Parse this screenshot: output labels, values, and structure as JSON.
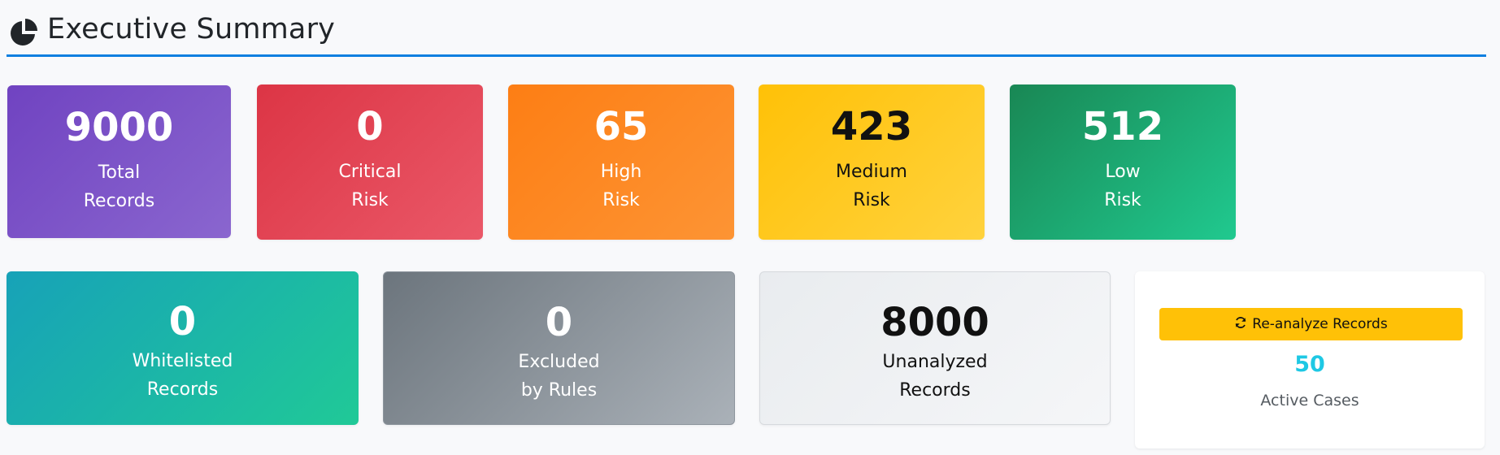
{
  "header": {
    "title": "Executive Summary",
    "icon": "pie-chart-icon",
    "accent": "#0d7fe0"
  },
  "risk_cards": [
    {
      "value": "9000",
      "label": "Total\nRecords",
      "color": "#7043c1"
    },
    {
      "value": "0",
      "label": "Critical\nRisk",
      "color": "#dc3545"
    },
    {
      "value": "65",
      "label": "High\nRisk",
      "color": "#fd7e14"
    },
    {
      "value": "423",
      "label": "Medium\nRisk",
      "color": "#ffc107"
    },
    {
      "value": "512",
      "label": "Low\nRisk",
      "color": "#198754"
    }
  ],
  "status_cards": [
    {
      "value": "0",
      "label": "Whitelisted\nRecords",
      "color": "#17a2b8"
    },
    {
      "value": "0",
      "label": "Excluded\nby Rules",
      "color": "#6c757d"
    },
    {
      "value": "8000",
      "label": "Unanalyzed\nRecords",
      "color": "#e9ecef"
    }
  ],
  "actions": {
    "reanalyze_label": "Re-analyze Records",
    "reanalyze_icon": "refresh-icon",
    "active_cases_count": "50",
    "active_cases_label": "Active Cases",
    "count_color": "#1ec8e4"
  }
}
